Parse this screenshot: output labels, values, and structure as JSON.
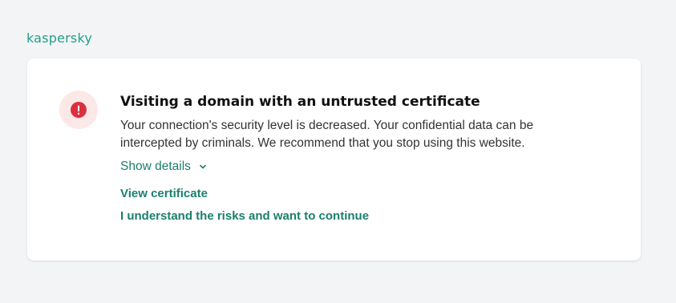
{
  "brand": {
    "logo_text": "kaspersky",
    "color": "#1f9f8c"
  },
  "alert": {
    "icon": "exclamation-circle-icon",
    "icon_color": "#d93040",
    "icon_bg": "#fde8e8",
    "title": "Visiting a domain with an untrusted certificate",
    "description": "Your connection's security level is decreased. Your confidential data can be intercepted by criminals. We recommend that you stop using this website.",
    "show_details_label": "Show details",
    "view_certificate_label": "View certificate",
    "continue_label": "I understand the risks and want to continue"
  },
  "colors": {
    "link": "#1a7f6e",
    "background": "#f3f4f6",
    "card": "#ffffff"
  }
}
